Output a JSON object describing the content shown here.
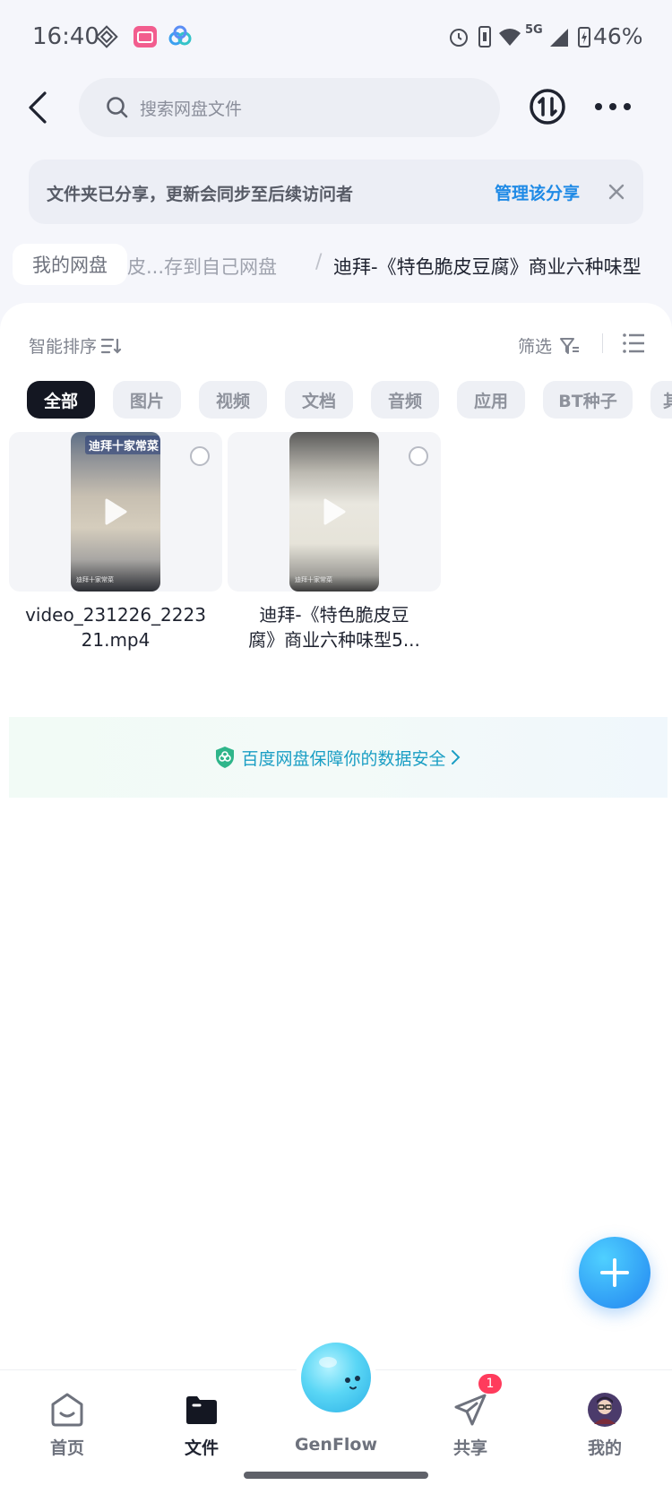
{
  "status_bar": {
    "time": "16:40",
    "battery": "46%",
    "network": "5G",
    "icons": [
      "diamond-icon",
      "bilibili-icon",
      "baidu-netdisk-icon",
      "alarm-icon",
      "vibrate-icon",
      "wifi-icon",
      "signal-icon",
      "battery-icon"
    ]
  },
  "top_bar": {
    "search_placeholder": "搜索网盘文件"
  },
  "share_banner": {
    "text": "文件夹已分享，更新会同步至后续访问者",
    "link": "管理该分享"
  },
  "breadcrumb": {
    "root": "我的网盘",
    "middle": "皮...存到自己网盘",
    "separator": "/",
    "current": "迪拜-《特色脆皮豆腐》商业六种味型"
  },
  "toolbar": {
    "sort_label": "智能排序",
    "filter_label": "筛选"
  },
  "chips": [
    "全部",
    "图片",
    "视频",
    "文档",
    "音频",
    "应用",
    "BT种子",
    "其"
  ],
  "files": [
    {
      "name_line1": "video_231226_2223",
      "name_line2": "21.mp4",
      "thumb_caption": "迪拜十家常菜",
      "thumb_footer": "迪拜十家常菜"
    },
    {
      "name_line1": "迪拜-《特色脆皮豆",
      "name_line2": "腐》商业六种味型5...",
      "thumb_caption": "",
      "thumb_footer": "迪拜十家常菜"
    }
  ],
  "security_notice": "百度网盘保障你的数据安全",
  "bottom_nav": {
    "home": "首页",
    "files": "文件",
    "genflow": "GenFlow",
    "share": "共享",
    "share_badge": "1",
    "me": "我的"
  },
  "colors": {
    "accent_blue": "#1f8ae6",
    "secure_teal": "#1a9ec4",
    "chip_active": "#141722",
    "badge_red": "#ff3b5c"
  }
}
